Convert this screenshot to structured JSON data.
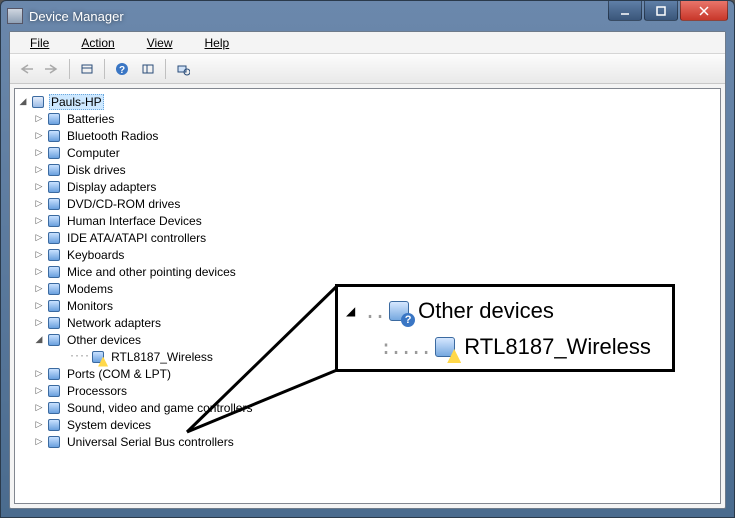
{
  "window": {
    "title": "Device Manager"
  },
  "menu": {
    "file": "File",
    "action": "Action",
    "view": "View",
    "help": "Help"
  },
  "tree": {
    "root": "Pauls-HP",
    "categories": [
      {
        "label": "Batteries"
      },
      {
        "label": "Bluetooth Radios"
      },
      {
        "label": "Computer"
      },
      {
        "label": "Disk drives"
      },
      {
        "label": "Display adapters"
      },
      {
        "label": "DVD/CD-ROM drives"
      },
      {
        "label": "Human Interface Devices"
      },
      {
        "label": "IDE ATA/ATAPI controllers"
      },
      {
        "label": "Keyboards"
      },
      {
        "label": "Mice and other pointing devices"
      },
      {
        "label": "Modems"
      },
      {
        "label": "Monitors"
      },
      {
        "label": "Network adapters"
      },
      {
        "label": "Other devices",
        "expanded": true,
        "children": [
          {
            "label": "RTL8187_Wireless",
            "warning": true
          }
        ]
      },
      {
        "label": "Ports (COM & LPT)"
      },
      {
        "label": "Processors"
      },
      {
        "label": "Sound, video and game controllers"
      },
      {
        "label": "System devices"
      },
      {
        "label": "Universal Serial Bus controllers"
      }
    ]
  },
  "callout": {
    "parent": "Other devices",
    "child": "RTL8187_Wireless"
  }
}
